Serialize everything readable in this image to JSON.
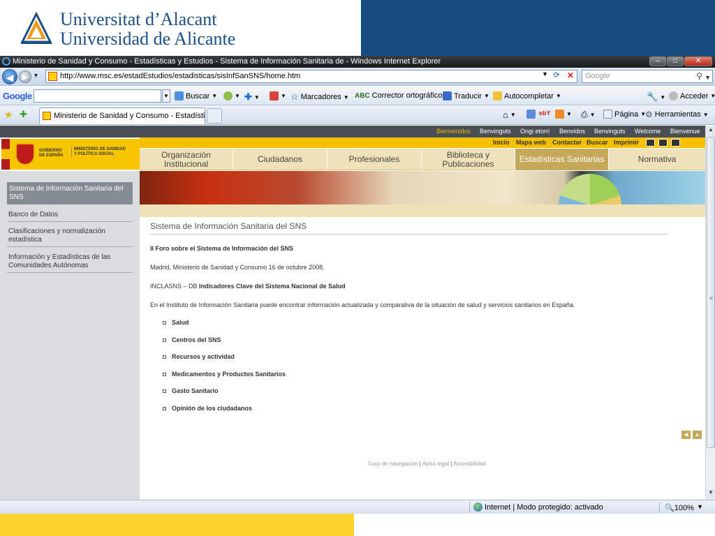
{
  "slide": {
    "university_line1": "Universitat d’Alacant",
    "university_line2": "Universidad de Alicante",
    "accent_blue": "#164d80",
    "accent_yellow": "#fdd32e"
  },
  "browser": {
    "window_title": "Ministerio de Sanidad y Consumo - Estadísticas y Estudios - Sistema de Información Sanitaria de - Windows Internet Explorer",
    "address": "http://www.msc.es/estadEstudios/estadisticas/sisInfSanSNS/home.htm",
    "search_placeholder": "Google",
    "google_toolbar": {
      "logo": "Google",
      "buscar": "Buscar",
      "marcadores": "Marcadores",
      "corrector": "Corrector ortográfico",
      "traducir": "Traducir",
      "autocompletar": "Autocompletar",
      "acceder": "Acceder"
    },
    "tab_title": "Ministerio de Sanidad y Consumo - Estadísticas y...",
    "command_bar": {
      "pagina": "Página",
      "herramientas": "Herramientas"
    },
    "status": {
      "zone": "Internet | Modo protegido: activado",
      "zoom": "100%"
    }
  },
  "site": {
    "languages": [
      "Bienvenidos",
      "Benvinguts",
      "Ongi etorri",
      "Benvidos",
      "Benvinguts",
      "Welcome",
      "Bienvenue"
    ],
    "gov_logo_text1": "GOBIERNO DE ESPAÑA",
    "gov_logo_text2": "MINISTERIO DE SANIDAD Y POLÍTICA SOCIAL",
    "utility_links": [
      "Inicio",
      "Mapa web",
      "Contactar",
      "Buscar",
      "Imprimir"
    ],
    "main_nav": [
      {
        "label": "Organización Institucional"
      },
      {
        "label": "Ciudadanos"
      },
      {
        "label": "Profesionales"
      },
      {
        "label": "Biblioteca y Publicaciones"
      },
      {
        "label": "Estadísticas Sanitarias"
      },
      {
        "label": "Normativa"
      }
    ],
    "sidebar": [
      "Sistema de Información Sanitaria del SNS",
      "Banco de Datos",
      "Clasificaciones y normalización estadística",
      "Información y Estadísticas de las Comunidades Autónomas"
    ],
    "content": {
      "title": "Sistema de Información Sanitaria del SNS",
      "foro": "II Foro sobre el Sistema de Información del SNS",
      "foro_detail": "Madrid, Ministerio de Sanidad y Consumo 16 de octubre 2008.",
      "inclasns_prefix": "INCLASNS – DB",
      "inclasns_bold": "Indicadores Clave del Sistema Nacional de Salud",
      "intro": "En el Instituto de Información Sanitaria puede encontrar información actualizada y comparativa de la situación de salud y servicios sanitarios en España.",
      "links": [
        "Salud",
        "Centros del SNS",
        "Recursos y actividad",
        "Medicamentos y Productos Sanitarios",
        "Gasto Sanitario",
        "Opinión de los ciudadanos"
      ]
    },
    "footer": {
      "guia": "Guía de navegación",
      "aviso": "Aviso legal",
      "accesibilidad": "Accesibilidad",
      "separator": "|"
    }
  }
}
